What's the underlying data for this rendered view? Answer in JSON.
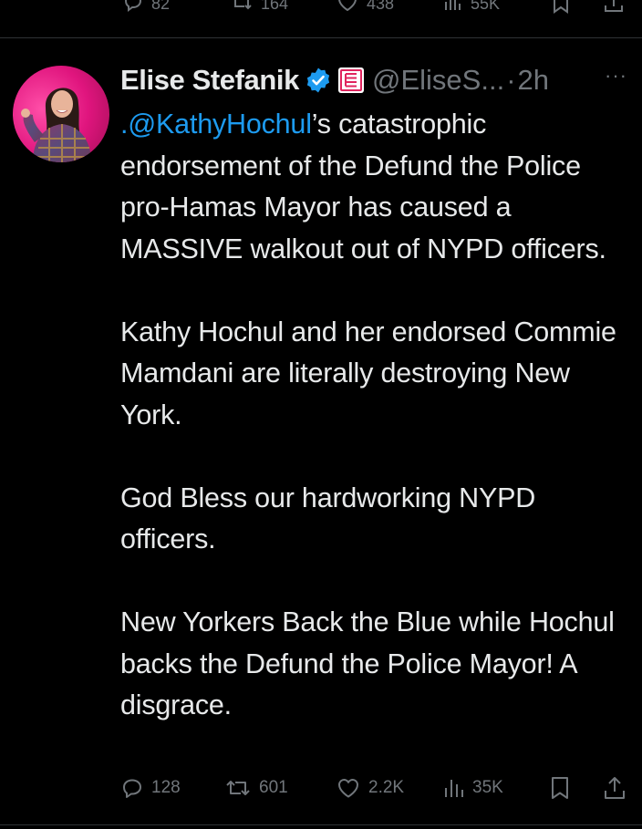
{
  "previous_tweet": {
    "actions": [
      {
        "icon": "reply-icon",
        "count": "82"
      },
      {
        "icon": "repost-icon",
        "count": "164"
      },
      {
        "icon": "like-icon",
        "count": "438"
      },
      {
        "icon": "views-icon",
        "count": "55K"
      }
    ]
  },
  "tweet": {
    "author": {
      "name": "Elise Stefanik",
      "handle": "@EliseS...",
      "verified_icon": "verified-badge-icon",
      "affiliation_icon": "affiliation-badge-icon"
    },
    "separator": "·",
    "time": "2h",
    "more_label": "···",
    "body": {
      "p1_mention": ".@KathyHochul",
      "p1_rest": "’s catastrophic endorsement of the Defund the Police pro-Hamas Mayor has caused a MASSIVE walkout out of NYPD officers.",
      "p2": "Kathy Hochul and her endorsed Commie Mamdani are literally destroying New York.",
      "p3": "God Bless our hardworking NYPD officers.",
      "p4": "New Yorkers Back the Blue while Hochul backs the Defund the Police Mayor! A disgrace."
    },
    "actions": {
      "replies": "128",
      "reposts": "601",
      "likes": "2.2K",
      "views": "35K"
    }
  },
  "colors": {
    "background": "#000000",
    "text": "#e7e9ea",
    "muted": "#71767b",
    "accent": "#1d9bf0",
    "divider": "#2f3336",
    "affiliation_red": "#e0245e"
  }
}
